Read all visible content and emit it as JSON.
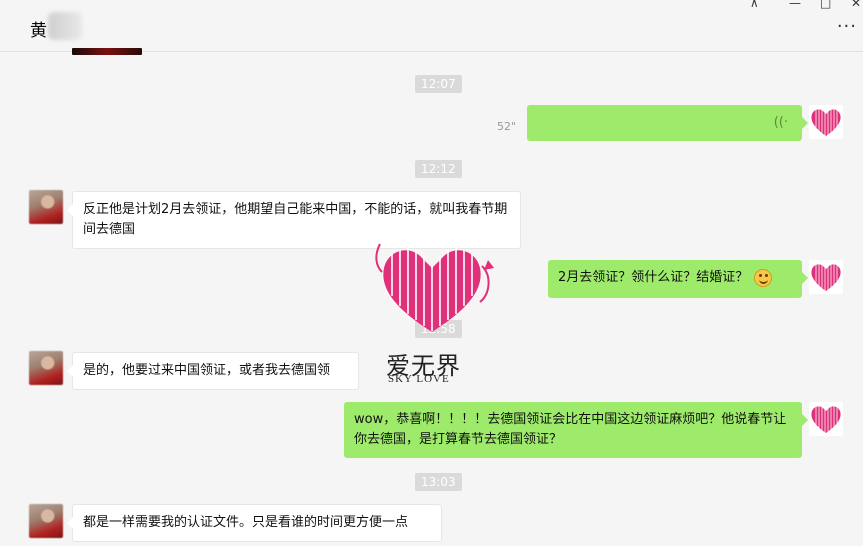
{
  "header": {
    "contact_name": "黄",
    "more_icon": "ellipsis-icon",
    "window_controls": [
      "pin-icon",
      "minimize-icon",
      "maximize-icon",
      "close-icon"
    ],
    "more_label": "···"
  },
  "timestamps": [
    "12:07",
    "12:12",
    "12:58",
    "13:03"
  ],
  "messages": [
    {
      "side": "right",
      "type": "voice",
      "duration": "52\""
    },
    {
      "side": "left",
      "text": "反正他是计划2月去领证，他期望自己能来中国，不能的话，就叫我春节期间去德国"
    },
    {
      "side": "right",
      "text": "2月去领证？领什么证？结婚证？",
      "emoji": "smile-icon"
    },
    {
      "side": "left",
      "text": "是的，他要过来中国领证，或者我去德国领"
    },
    {
      "side": "right",
      "text": "wow，恭喜啊！！！！去德国领证会比在中国这边领证麻烦吧？他说春节让你去德国，是打算春节去德国领证？"
    },
    {
      "side": "left",
      "text": "都是一样需要我的认证文件。只是看谁的时间更方便一点"
    }
  ],
  "watermark": {
    "cn": "爱无界",
    "en": "SKY LOVE"
  },
  "colors": {
    "bubble_right": "#9eea6a",
    "bubble_left": "#ffffff",
    "background": "#f5f5f5",
    "brand_pink": "#e0307a"
  }
}
